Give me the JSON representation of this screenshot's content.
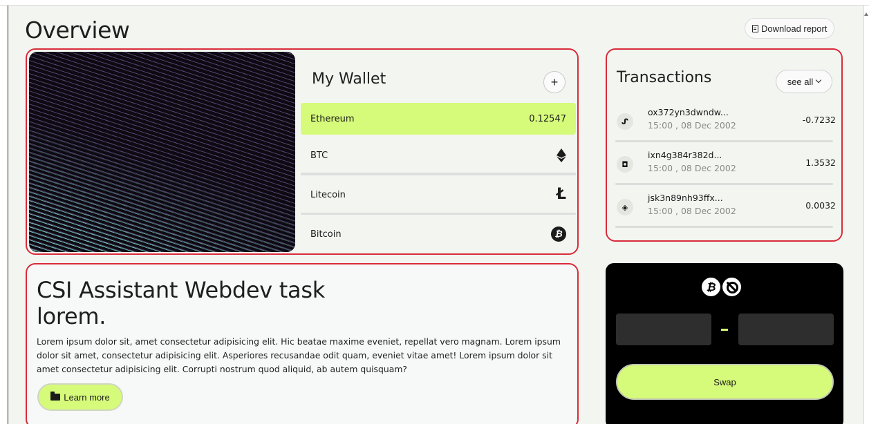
{
  "page": {
    "title": "Overview",
    "download_label": "Download report"
  },
  "wallet": {
    "title": "My Wallet",
    "add_label": "+",
    "items": [
      {
        "name": "Ethereum",
        "value": "0.12547",
        "icon": "none",
        "active": true
      },
      {
        "name": "BTC",
        "value": "",
        "icon": "ethereum-icon",
        "active": false
      },
      {
        "name": "Litecoin",
        "value": "",
        "icon": "litecoin-icon",
        "active": false
      },
      {
        "name": "Bitcoin",
        "value": "",
        "icon": "bitcoin-icon",
        "active": false
      }
    ],
    "ltc_glyph": "Ł",
    "btc_glyph": "₿"
  },
  "transactions": {
    "title": "Transactions",
    "see_all_label": "see all",
    "items": [
      {
        "hash": "ox372yn3dwndw...",
        "date": "15:00 , 08 Dec 2002",
        "amount": "-0.7232",
        "icon": "stumbleupon-icon",
        "glyph": "ᔑ"
      },
      {
        "hash": "ixn4g384r382d...",
        "date": "15:00 , 08 Dec 2002",
        "amount": "1.3532",
        "icon": "box-icon",
        "glyph": "◘"
      },
      {
        "hash": "jsk3n89nh93ffx...",
        "date": "15:00 , 08 Dec 2002",
        "amount": "0.0032",
        "icon": "drop-icon",
        "glyph": "◈"
      }
    ]
  },
  "promo": {
    "title": "CSI Assistant Webdev task lorem.",
    "body": "Lorem ipsum dolor sit, amet consectetur adipisicing elit. Hic beatae maxime eveniet, repellat vero magnam. Lorem ipsum dolor sit amet, consectetur adipisicing elit. Asperiores recusandae odit quam, eveniet vitae amet! Lorem ipsum dolor sit amet consectetur adipisicing elit. Corrupti nostrum quod aliquid, ab autem quisquam?",
    "learn_more_label": "Learn more"
  },
  "swap": {
    "from_glyph": "₿",
    "swap_label": "Swap",
    "from_value": "",
    "to_value": ""
  },
  "colors": {
    "accent": "#d6fa7a",
    "highlight_border": "#d92b3a",
    "dark_card": "#000000"
  }
}
